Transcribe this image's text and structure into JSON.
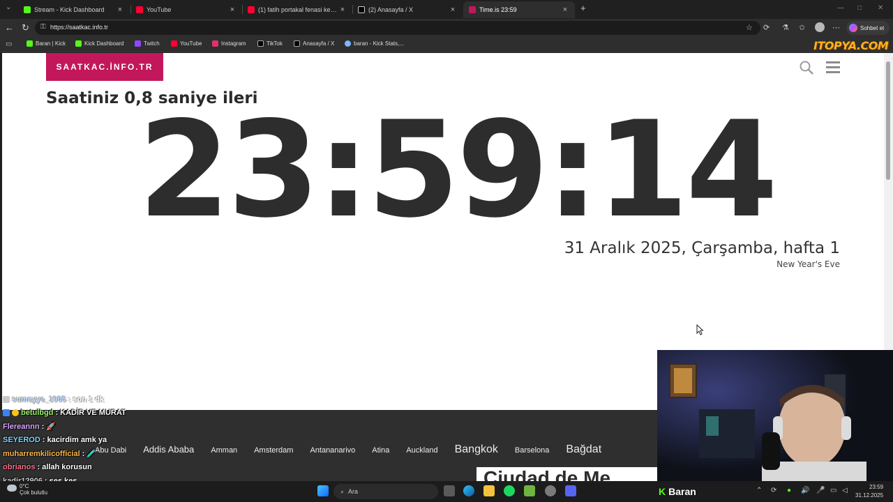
{
  "browser": {
    "tabs": [
      {
        "title": "Stream - Kick Dashboard",
        "color": "#53fc18",
        "active": false
      },
      {
        "title": "YouTube",
        "color": "#ff0033",
        "active": false
      },
      {
        "title": "(1) fatih portakal fenasi kerim - Yo",
        "color": "#ff0033",
        "active": false
      },
      {
        "title": "(2) Anasayfa / X",
        "color": "#ffffff",
        "active": false
      },
      {
        "title": "Time.is 23:59",
        "color": "#c2185b",
        "active": true
      }
    ],
    "url": "https://saatkac.info.tr",
    "chat_button_label": "Sohbet et",
    "bookmarks": [
      {
        "label": "Baran | Kick",
        "color": "#53fc18"
      },
      {
        "label": "Kick Dashboard",
        "color": "#53fc18"
      },
      {
        "label": "Twitch",
        "color": "#9146ff"
      },
      {
        "label": "YouTube",
        "color": "#ff0033"
      },
      {
        "label": "Instagram",
        "color": "#e1306c"
      },
      {
        "label": "TikTok",
        "color": "#ffffff"
      },
      {
        "label": "Anasayfa / X",
        "color": "#ffffff"
      },
      {
        "label": "baran - Kick Stats,...",
        "color": "#7ab8ff"
      }
    ]
  },
  "watermark": "ITOPYA.COM",
  "page": {
    "brand": "SAATKAC.İNFO.TR",
    "subtitle": "Saatiniz 0,8 saniye ileri",
    "time": "23:59:14",
    "date": "31 Aralık 2025, Çarşamba, hafta 1",
    "holiday": "New Year's Eve",
    "cities": [
      "Abu Dabi",
      "Addis Ababa",
      "Amman",
      "Amsterdam",
      "Antananarivo",
      "Atina",
      "Auckland",
      "Bangkok",
      "Barselona",
      "Bağdat"
    ],
    "banner_text": "Ciudad de Me"
  },
  "chat": [
    {
      "user": "sumeyye_1905",
      "message": ": son 1 dk",
      "color": "#7ab8ff",
      "faded": true
    },
    {
      "user": "betulbgd",
      "message": ": KADİR VE MURAT",
      "color": "#9ef36b",
      "faded": false
    },
    {
      "user": "Flereannn",
      "message": ": 🚀",
      "color": "#d9a6ff",
      "faded": false
    },
    {
      "user": "SEYEROD",
      "message": ": kacirdim amk ya",
      "color": "#7fd6ff",
      "faded": false
    },
    {
      "user": "muharremkilicofficial",
      "message": ": 🧪",
      "color": "#ffb84d",
      "faded": false
    },
    {
      "user": "obrianos",
      "message": ": allah korusun",
      "color": "#ff6f8a",
      "faded": false
    },
    {
      "user": "kadir12906",
      "message": ": ses kes",
      "color": "#cfcfcf",
      "faded": false
    }
  ],
  "taskbar": {
    "weather_temp": "0°C",
    "weather_desc": "Çok bulutlu",
    "search_placeholder": "Ara",
    "streamer_name": "Baran",
    "time": "23:59",
    "date": "31.12.2025"
  }
}
